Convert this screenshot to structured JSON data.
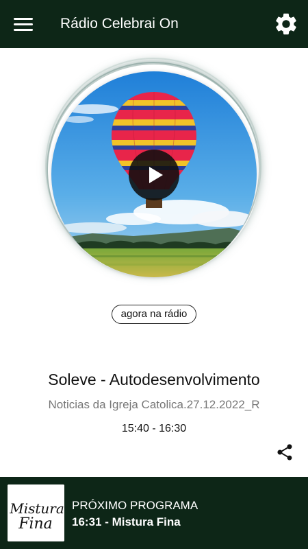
{
  "header": {
    "title": "Rádio Celebrai On",
    "menu_icon": "hamburger-menu-icon",
    "settings_icon": "gear-icon",
    "background_color": "#0d2617"
  },
  "now_playing": {
    "badge": "agora na rádio",
    "title": "Soleve - Autodesenvolvimento",
    "subtitle": "Noticias da Igreja Catolica.27.12.2022_R",
    "time": "15:40 - 16:30",
    "artwork": "hot-air-balloon-image",
    "play_icon": "play-icon",
    "share_icon": "share-icon"
  },
  "next_program": {
    "label": "PRÓXIMO PROGRAMA",
    "program": "16:31 - Mistura Fina",
    "thumbnail_text_1": "Mistura",
    "thumbnail_text_2": "Fina"
  }
}
